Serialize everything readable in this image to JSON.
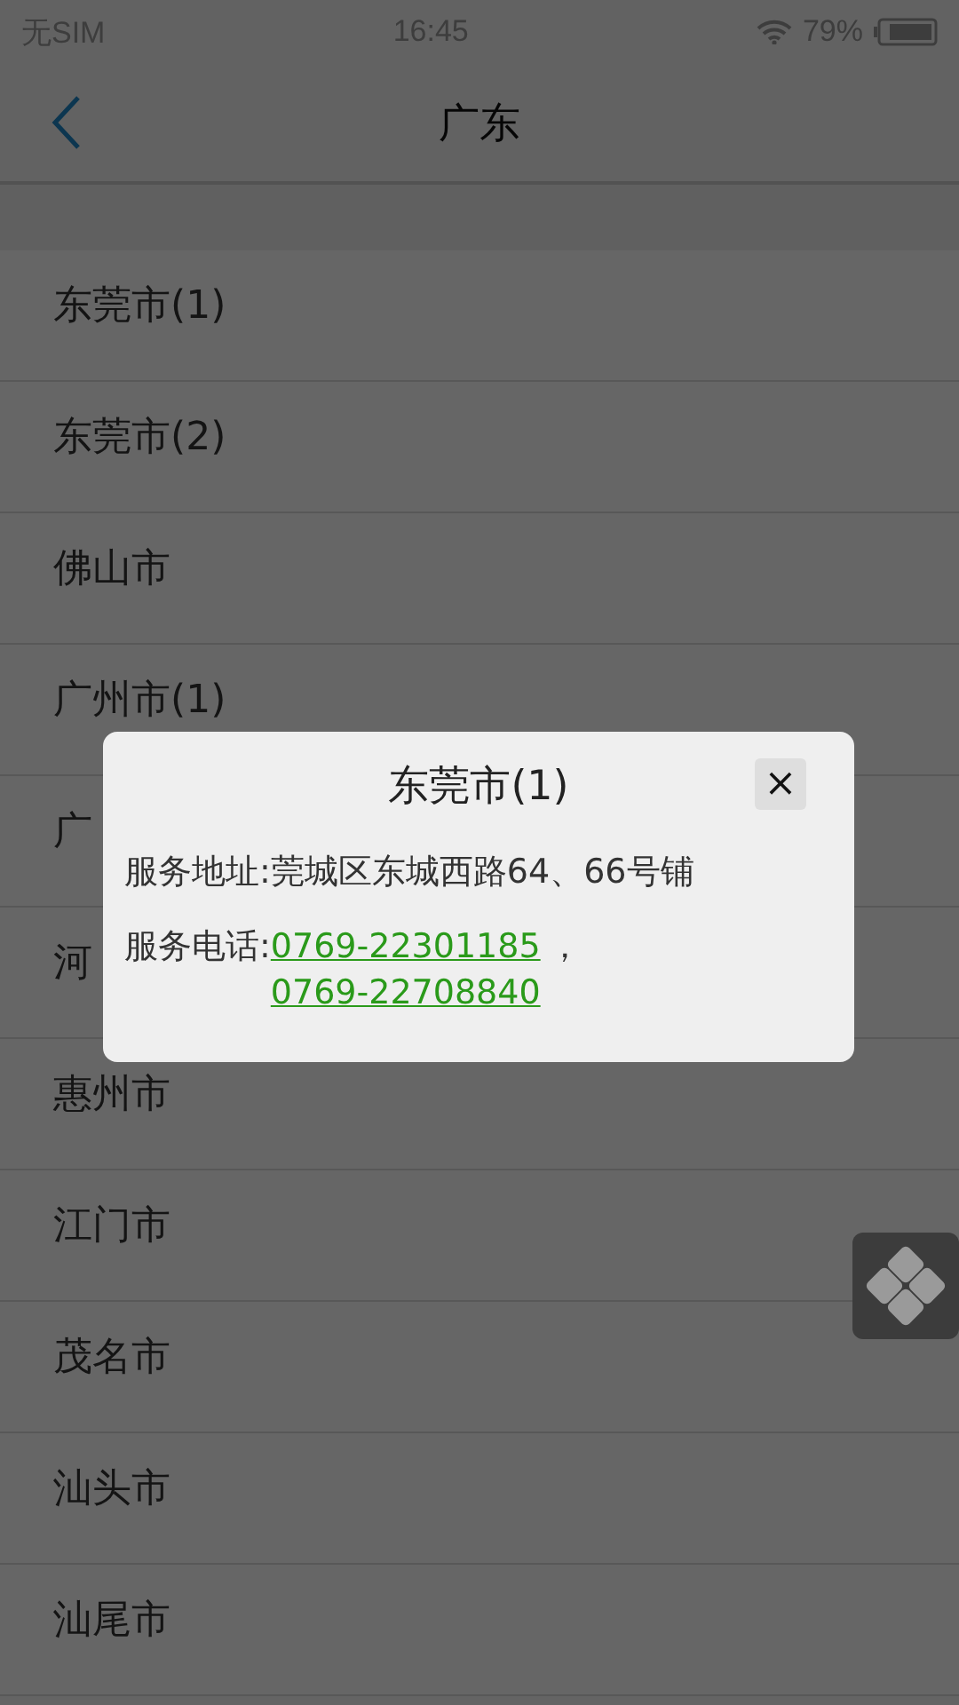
{
  "status_bar": {
    "carrier": "无SIM",
    "time": "16:45",
    "battery": "79%"
  },
  "header": {
    "title": "广东"
  },
  "list": {
    "items": [
      {
        "label": "东莞市(1)"
      },
      {
        "label": "东莞市(2)"
      },
      {
        "label": "佛山市"
      },
      {
        "label": "广州市(1)"
      },
      {
        "label": "广"
      },
      {
        "label": "河"
      },
      {
        "label": "惠州市"
      },
      {
        "label": "江门市"
      },
      {
        "label": "茂名市"
      },
      {
        "label": "汕头市"
      },
      {
        "label": "汕尾市"
      }
    ]
  },
  "dialog": {
    "title": "东莞市(1)",
    "close": "×",
    "address_label": "服务地址:",
    "address": "莞城区东城西路64、66号铺",
    "phone_label": "服务电话:",
    "phones": [
      "0769-22301185",
      "0769-22708840"
    ],
    "separator": "，"
  }
}
